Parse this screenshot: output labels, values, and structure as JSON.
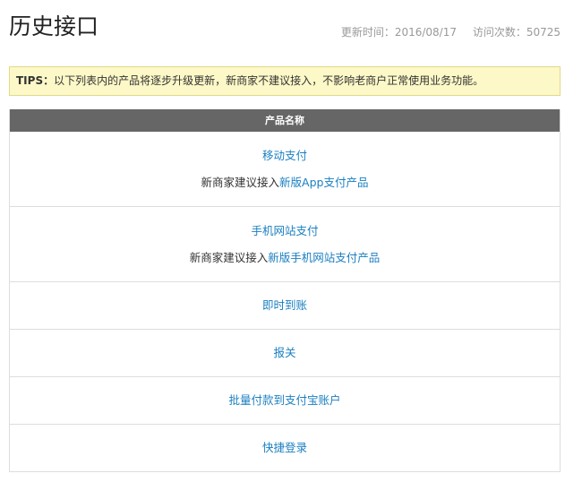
{
  "header": {
    "title": "历史接口",
    "update_time": "更新时间：2016/08/17",
    "visit_count": "访问次数：50725"
  },
  "tips": {
    "label": "TIPS：",
    "text": "以下列表内的产品将逐步升级更新，新商家不建议接入，不影响老商户正常使用业务功能。"
  },
  "table": {
    "column_header": "产品名称",
    "rows": [
      {
        "name": "移动支付",
        "note_prefix": "新商家建议接入",
        "note_link": "新版App支付产品"
      },
      {
        "name": "手机网站支付",
        "note_prefix": "新商家建议接入",
        "note_link": "新版手机网站支付产品"
      },
      {
        "name": "即时到账"
      },
      {
        "name": "报关"
      },
      {
        "name": "批量付款到支付宝账户"
      },
      {
        "name": "快捷登录"
      }
    ]
  },
  "colors": {
    "link": "#1a7fc1",
    "tips_background": "#fcf8c7",
    "table_header_background": "#666666"
  }
}
